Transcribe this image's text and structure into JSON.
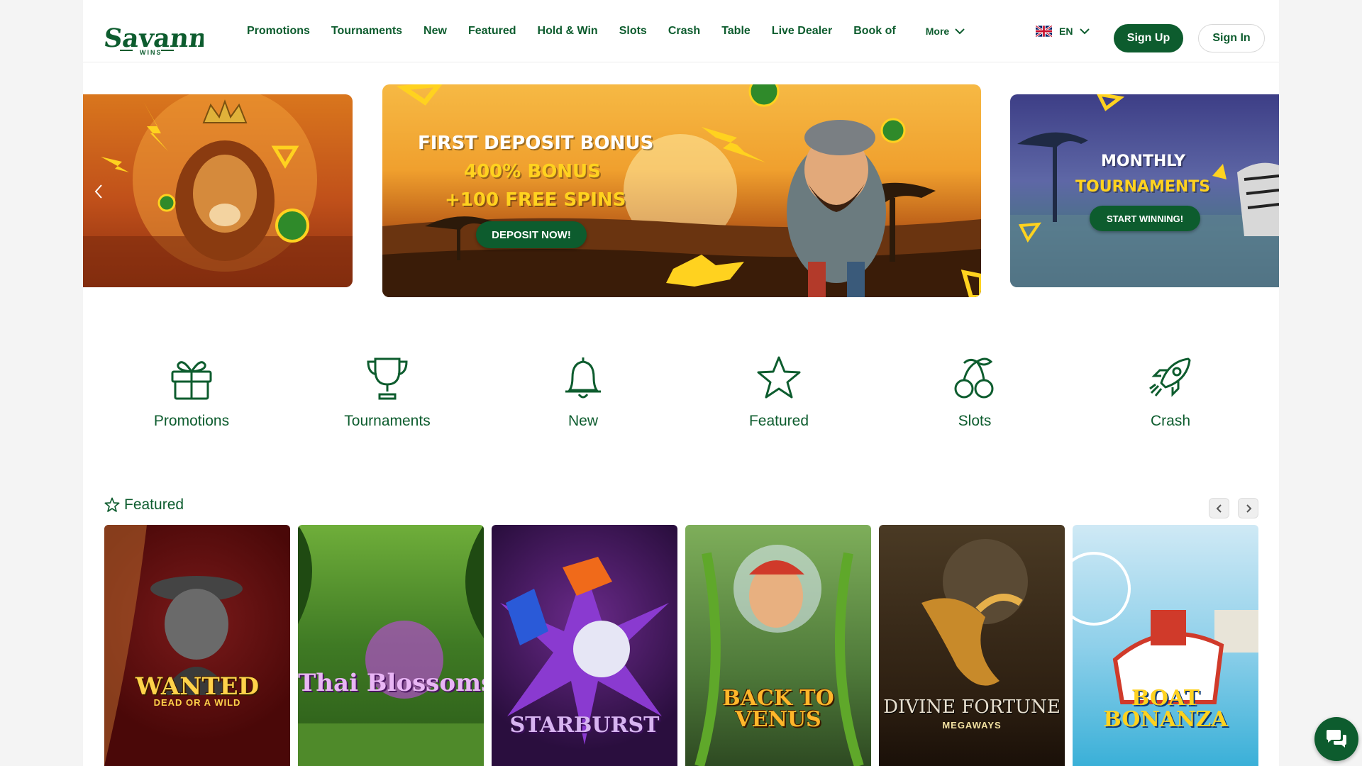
{
  "header": {
    "logo_text": "Savanna Wins",
    "nav": [
      "Promotions",
      "Tournaments",
      "New",
      "Featured",
      "Hold & Win",
      "Slots",
      "Crash",
      "Table",
      "Live Dealer",
      "Book of"
    ],
    "more_label": "More",
    "language": "EN",
    "signup_label": "Sign Up",
    "signin_label": "Sign In"
  },
  "banners": {
    "main": {
      "line1": "FIRST DEPOSIT BONUS",
      "line2": "400% BONUS",
      "line3": "+100 FREE SPINS",
      "button": "DEPOSIT NOW!"
    },
    "right": {
      "line1": "MONTHLY",
      "line2": "TOURNAMENTS",
      "button": "START WINNING!"
    }
  },
  "categories": [
    {
      "label": "Promotions",
      "icon": "gift-icon"
    },
    {
      "label": "Tournaments",
      "icon": "trophy-icon"
    },
    {
      "label": "New",
      "icon": "bell-icon"
    },
    {
      "label": "Featured",
      "icon": "star-icon"
    },
    {
      "label": "Slots",
      "icon": "cherries-icon"
    },
    {
      "label": "Crash",
      "icon": "rocket-icon"
    }
  ],
  "featured": {
    "title": "Featured",
    "games": [
      {
        "title": "WANTED",
        "subtitle": "DEAD OR A WILD",
        "bg": "#6b0f0f"
      },
      {
        "title": "Thai Blossoms",
        "subtitle": "",
        "bg": "#3f7a24"
      },
      {
        "title": "STARBURST",
        "subtitle": "",
        "bg": "#3a1555"
      },
      {
        "title": "BACK TO VENUS",
        "subtitle": "",
        "bg": "#4f7a3a"
      },
      {
        "title": "DIVINE FORTUNE",
        "subtitle": "MEGAWAYS",
        "bg": "#3a2a18"
      },
      {
        "title": "BOAT BONANZA",
        "subtitle": "",
        "bg": "#7fc6e6"
      }
    ]
  },
  "colors": {
    "brand_green": "#0d5c2e",
    "banner_yellow": "#ffd21f"
  }
}
